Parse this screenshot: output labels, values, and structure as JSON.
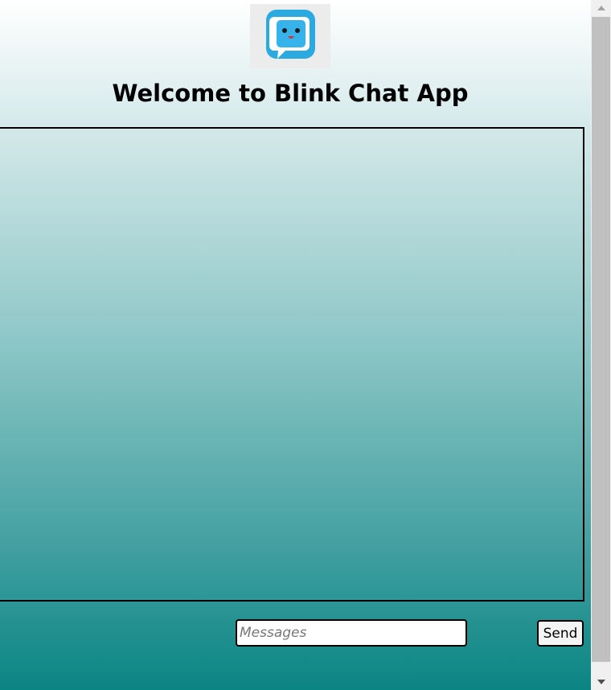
{
  "app": {
    "title": "Welcome to Blink Chat App",
    "logo_icon": "chat-bubble-face-icon"
  },
  "composer": {
    "placeholder": "Messages",
    "value": "",
    "send_label": "Send"
  },
  "colors": {
    "gradient_top": "#ffffff",
    "gradient_bottom": "#0b8584",
    "logo_blue": "#2ba9e1"
  }
}
